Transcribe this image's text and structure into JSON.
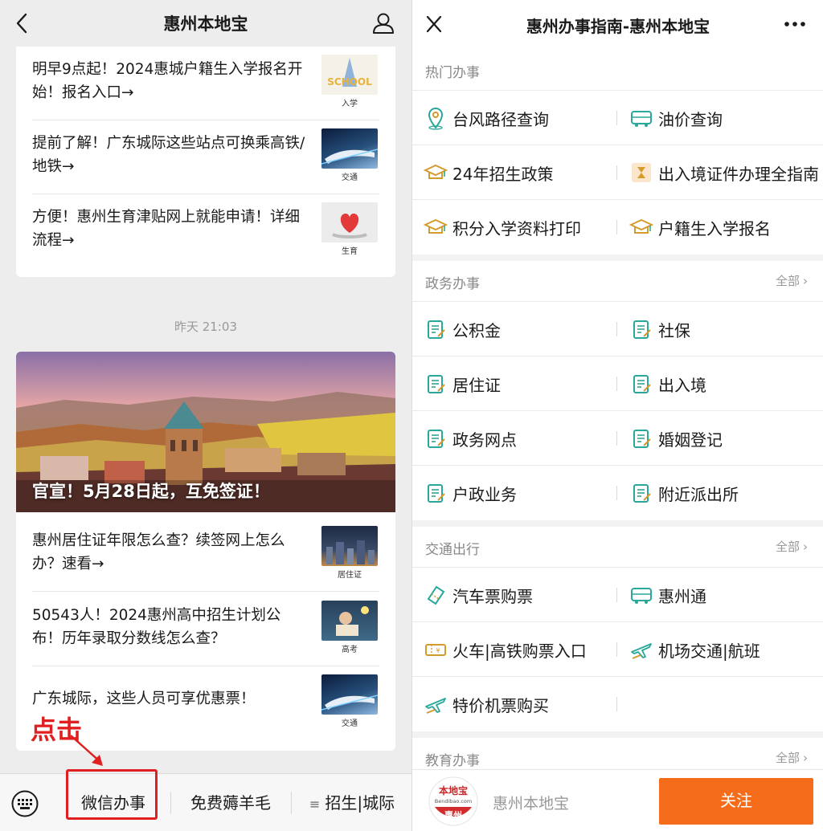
{
  "left": {
    "header": {
      "title": "惠州本地宝"
    },
    "articles_top": [
      {
        "title": "明早9点起！2024惠城户籍生入学报名开始！报名入口→",
        "thumb_label": "入学",
        "thumb_text": "SCHOOL"
      },
      {
        "title": "提前了解！广东城际这些站点可换乘高铁/地铁→",
        "thumb_label": "交通"
      },
      {
        "title": "方便！惠州生育津贴网上就能申请！详细流程→",
        "thumb_label": "生育"
      }
    ],
    "timestamp": "昨天 21:03",
    "hero": {
      "caption": "官宣！5月28日起，互免签证！"
    },
    "articles_bottom": [
      {
        "title": "惠州居住证年限怎么查？续签网上怎么办？速看→",
        "thumb_label": "居住证"
      },
      {
        "title": "50543人！2024惠州高中招生计划公布！历年录取分数线怎么查？",
        "thumb_label": "高考"
      },
      {
        "title": "广东城际，这些人员可享优惠票！",
        "thumb_label": "交通"
      }
    ],
    "annotation": "点击",
    "menu": [
      {
        "label": "微信办事"
      },
      {
        "label": "免费薅羊毛"
      },
      {
        "label": "招生|城际"
      }
    ],
    "colors": {
      "annotation": "#e02020"
    }
  },
  "right": {
    "header": {
      "title": "惠州办事指南-惠州本地宝"
    },
    "sections": [
      {
        "title": "热门办事",
        "all": "",
        "rows": [
          [
            {
              "label": "台风路径查询",
              "icon": "location-pin-icon"
            },
            {
              "label": "油价查询",
              "icon": "bus-icon"
            }
          ],
          [
            {
              "label": "24年招生政策",
              "icon": "graduation-cap-icon"
            },
            {
              "label": "出入境证件办理全指南",
              "icon": "hourglass-icon"
            }
          ],
          [
            {
              "label": "积分入学资料打印",
              "icon": "graduation-cap-icon"
            },
            {
              "label": "户籍生入学报名",
              "icon": "graduation-cap-icon"
            }
          ]
        ]
      },
      {
        "title": "政务办事",
        "all": "全部",
        "rows": [
          [
            {
              "label": "公积金",
              "icon": "document-icon"
            },
            {
              "label": "社保",
              "icon": "document-icon"
            }
          ],
          [
            {
              "label": "居住证",
              "icon": "document-icon"
            },
            {
              "label": "出入境",
              "icon": "document-icon"
            }
          ],
          [
            {
              "label": "政务网点",
              "icon": "document-icon"
            },
            {
              "label": "婚姻登记",
              "icon": "document-icon"
            }
          ],
          [
            {
              "label": "户政业务",
              "icon": "document-icon"
            },
            {
              "label": "附近派出所",
              "icon": "document-icon"
            }
          ]
        ]
      },
      {
        "title": "交通出行",
        "all": "全部",
        "rows": [
          [
            {
              "label": "汽车票购票",
              "icon": "ticket-icon"
            },
            {
              "label": "惠州通",
              "icon": "bus-icon"
            }
          ],
          [
            {
              "label": "火车|高铁购票入口",
              "icon": "train-ticket-icon"
            },
            {
              "label": "机场交通|航班",
              "icon": "airplane-icon"
            }
          ],
          [
            {
              "label": "特价机票购买",
              "icon": "airplane-icon"
            },
            {
              "label": "",
              "icon": ""
            }
          ]
        ]
      },
      {
        "title": "教育办事",
        "all": "全部",
        "rows": []
      }
    ],
    "follow_bar": {
      "brand_name": "惠州本地宝",
      "logo_text": "本地宝",
      "logo_sub": "Bendibao.com",
      "logo_city": "惠州",
      "button": "关注"
    },
    "colors": {
      "accent": "#f56d1b",
      "icon_teal": "#2aa79b",
      "icon_gold": "#d39a2c"
    }
  }
}
